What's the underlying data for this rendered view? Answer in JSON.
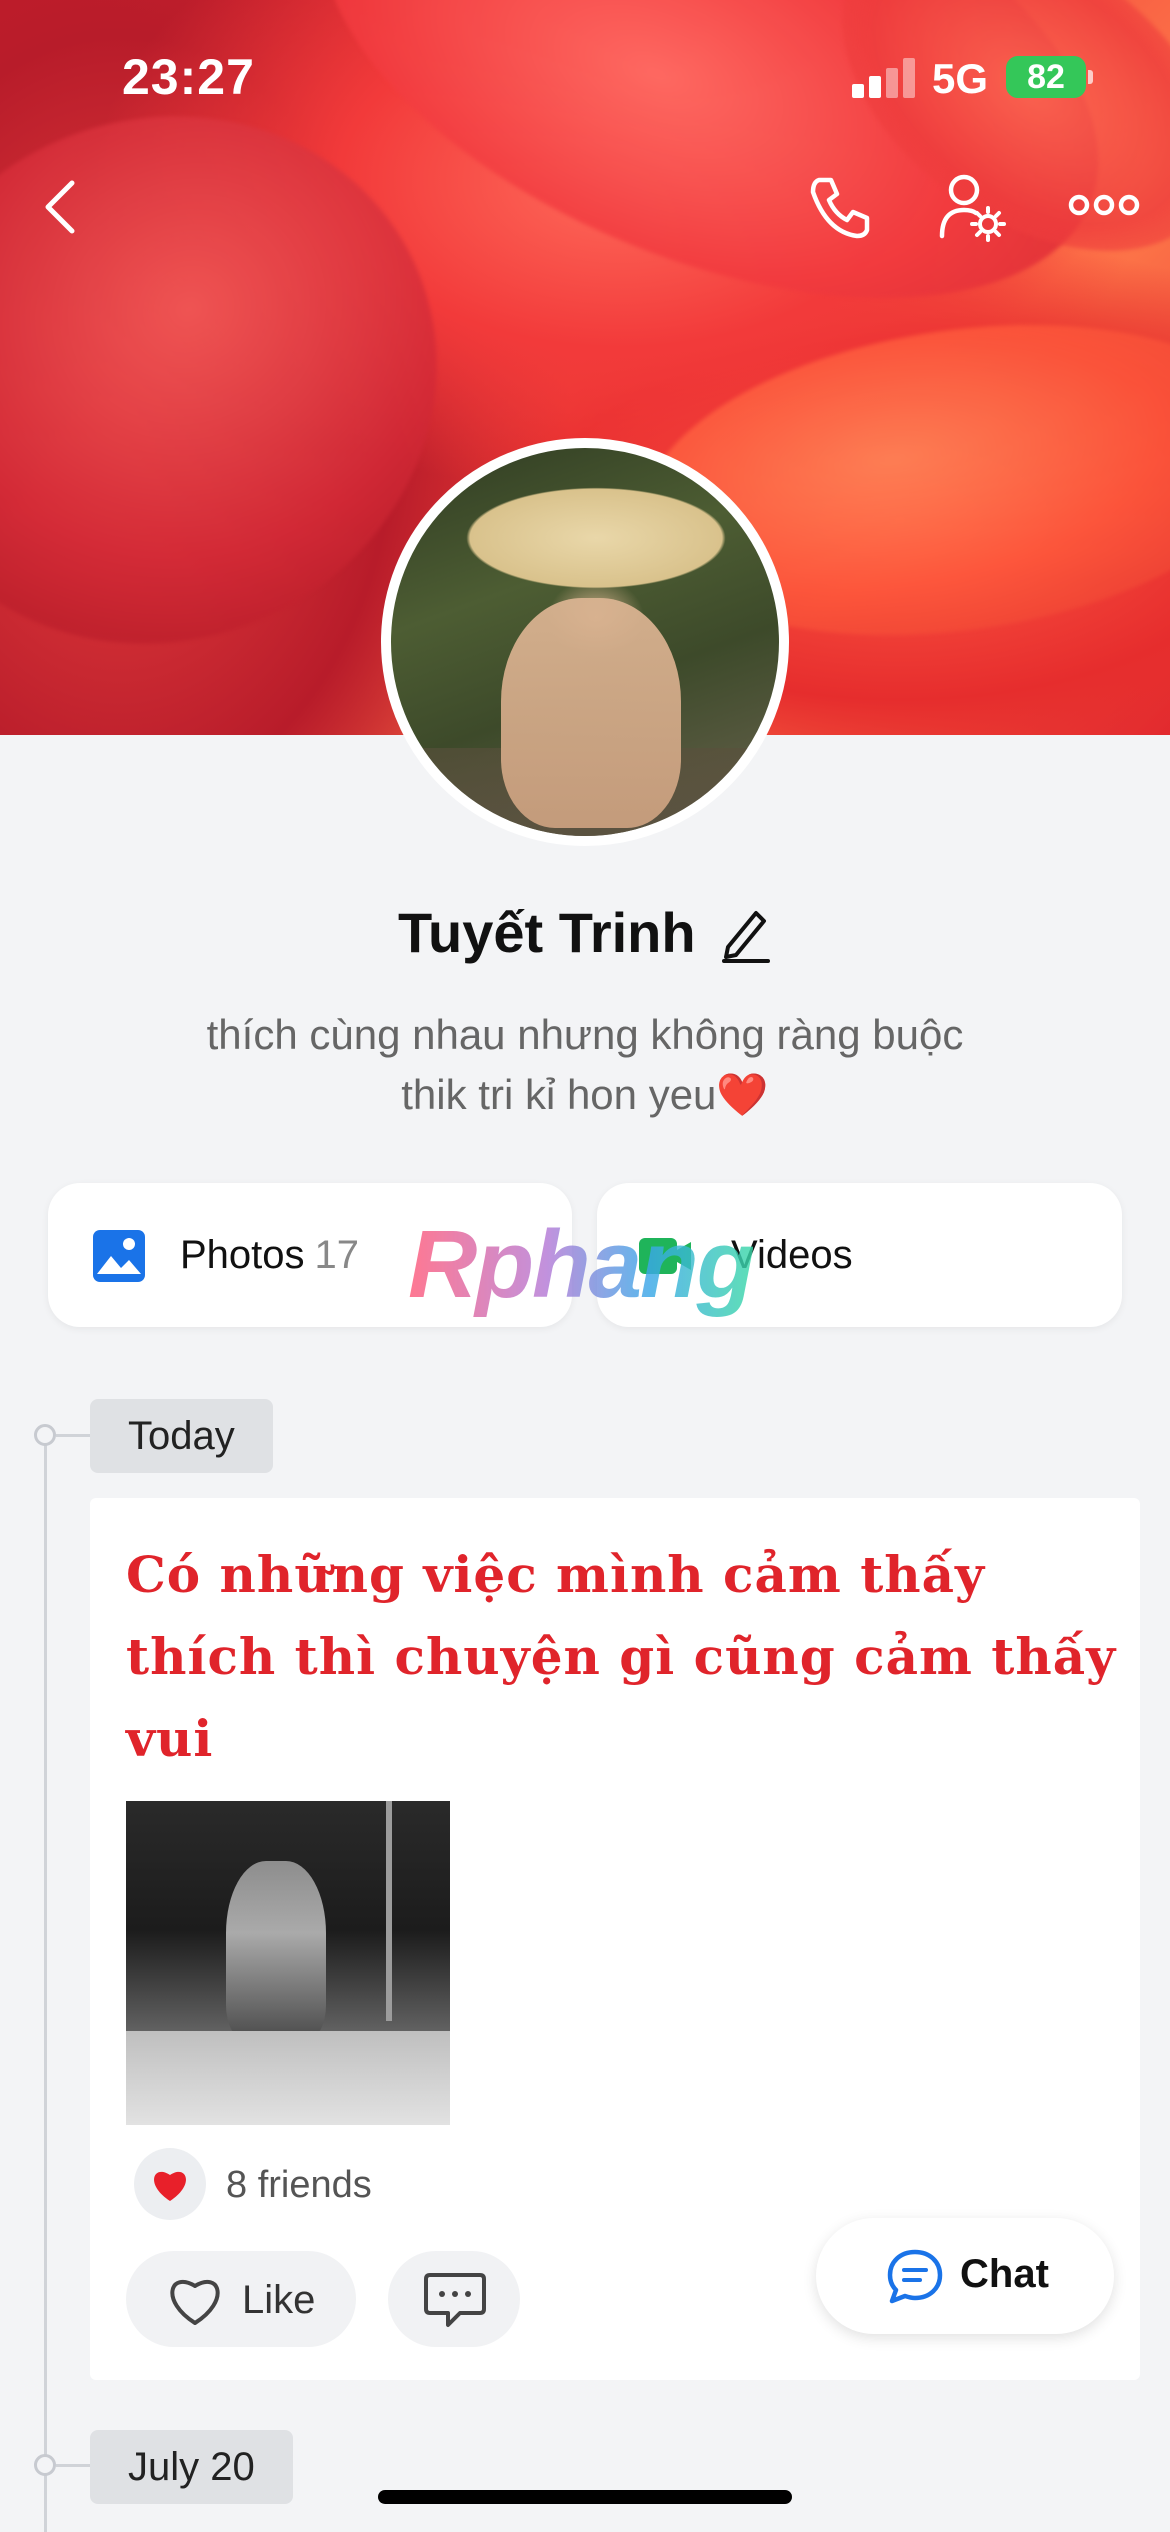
{
  "status_bar": {
    "time": "23:27",
    "network": "5G",
    "battery": "82"
  },
  "header": {
    "back_icon": "chevron-left-icon",
    "actions": [
      "phone-icon",
      "user-settings-icon",
      "more-icon"
    ]
  },
  "profile": {
    "name": "Tuyết Trinh",
    "bio_line1": "thích cùng nhau nhưng không ràng buộc",
    "bio_line2": "thik tri kỉ hon yeu❤️"
  },
  "media": {
    "photos_label": "Photos",
    "photos_count": "17",
    "videos_label": "Videos"
  },
  "watermark": "Rphang",
  "timeline": {
    "today_label": "Today",
    "next_label": "July 20"
  },
  "post": {
    "text": "Có những việc mình cảm thấy thích thì chuyện gì cũng cảm thấy vui",
    "reaction_label": "8 friends",
    "like_label": "Like"
  },
  "chat_fab": {
    "label": "Chat"
  },
  "colors": {
    "accent": "#1a73e8",
    "post_text": "#e0242b",
    "battery": "#34c759"
  }
}
